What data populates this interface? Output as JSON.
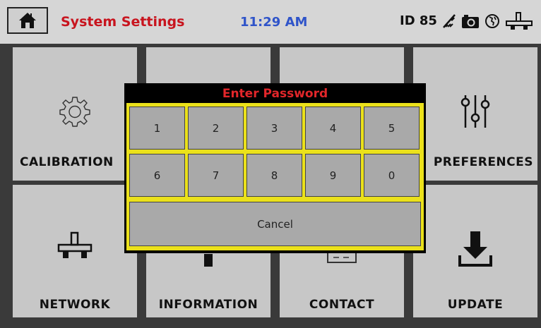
{
  "header": {
    "title": "System Settings",
    "time": "11:29 AM",
    "device_id": "ID 85",
    "title_color": "#c8141e",
    "time_color": "#2f54c9",
    "icons": [
      "home-icon",
      "usb-disconnected-icon",
      "camera-icon",
      "globe-icon",
      "network-icon"
    ]
  },
  "tiles": [
    {
      "label": "CALIBRATION",
      "icon": "gear-icon"
    },
    {
      "label": "",
      "icon": ""
    },
    {
      "label": "",
      "icon": ""
    },
    {
      "label": "PREFERENCES",
      "icon": "sliders-icon"
    },
    {
      "label": "NETWORK",
      "icon": "network-icon"
    },
    {
      "label": "INFORMATION",
      "icon": "info-icon"
    },
    {
      "label": "CONTACT",
      "icon": "contact-card-icon"
    },
    {
      "label": "UPDATE",
      "icon": "download-icon"
    }
  ],
  "dialog": {
    "title": "Enter Password",
    "keys": [
      "1",
      "2",
      "3",
      "4",
      "5",
      "6",
      "7",
      "8",
      "9",
      "0"
    ],
    "cancel_label": "Cancel",
    "title_color": "#e2262a",
    "frame_color": "#ebe11b"
  }
}
